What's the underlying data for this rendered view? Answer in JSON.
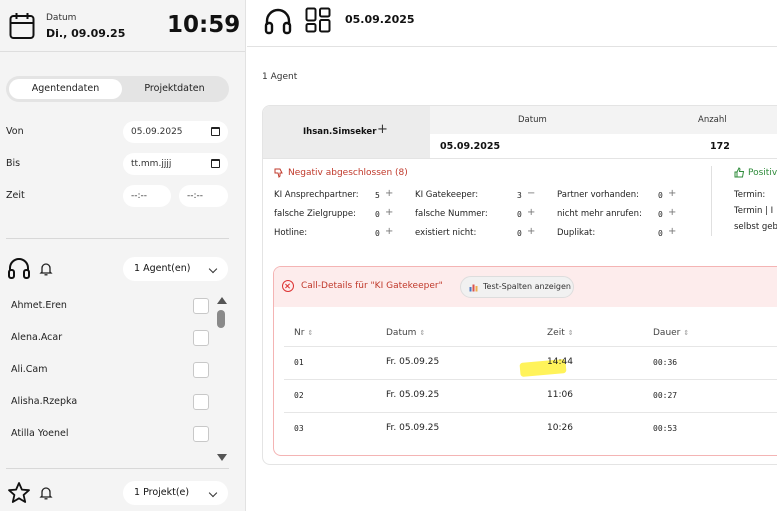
{
  "sidebar": {
    "date_label": "Datum",
    "date_value": "Di., 09.09.25",
    "clock": "10:59",
    "tabs": {
      "active": "Agentendaten",
      "inactive": "Projektdaten"
    },
    "filters": {
      "von_label": "Von",
      "von_value": "05.09.2025",
      "bis_label": "Bis",
      "bis_placeholder": "tt.mm.jjjj",
      "zeit_label": "Zeit",
      "zeit_from": "--:--",
      "zeit_to": "--:--"
    },
    "agents_dropdown": "1 Agent(en)",
    "agents": [
      "Ahmet.Eren",
      "Alena.Acar",
      "Ali.Cam",
      "Alisha.Rzepka",
      "Atilla Yoenel"
    ],
    "projects_dropdown": "1 Projekt(e)"
  },
  "topbar": {
    "date": "05.09.2025"
  },
  "main": {
    "agent_count": "1 Agent",
    "agent_tab": "Ihsan.Simseker",
    "columns": {
      "datum": "Datum",
      "anzahl": "Anzahl"
    },
    "row": {
      "datum": "05.09.2025",
      "anzahl": "172"
    },
    "negative": {
      "title": "Negativ abgeschlossen (8)",
      "items": [
        {
          "label": "KI Ansprechpartner:",
          "value": "5",
          "op": "+"
        },
        {
          "label": "falsche Zielgruppe:",
          "value": "0",
          "op": "+"
        },
        {
          "label": "Hotline:",
          "value": "0",
          "op": "+"
        },
        {
          "label": "KI Gatekeeper:",
          "value": "3",
          "op": "−"
        },
        {
          "label": "falsche Nummer:",
          "value": "0",
          "op": "+"
        },
        {
          "label": "existiert nicht:",
          "value": "0",
          "op": "+"
        },
        {
          "label": "Partner vorhanden:",
          "value": "0",
          "op": "+"
        },
        {
          "label": "nicht mehr anrufen:",
          "value": "0",
          "op": "+"
        },
        {
          "label": "Duplikat:",
          "value": "0",
          "op": "+"
        }
      ]
    },
    "positive": {
      "title": "Positiv",
      "items": [
        "Termin:",
        "Termin | I",
        "selbst geb"
      ]
    },
    "call_details": {
      "title": "Call-Details für \"KI Gatekeeper\"",
      "button": "Test-Spalten anzeigen",
      "headers": [
        "Nr",
        "Datum",
        "Zeit",
        "Dauer"
      ],
      "rows": [
        {
          "nr": "01",
          "datum": "Fr. 05.09.25",
          "zeit": "14:44",
          "dauer": "00:36"
        },
        {
          "nr": "02",
          "datum": "Fr. 05.09.25",
          "zeit": "11:06",
          "dauer": "00:27"
        },
        {
          "nr": "03",
          "datum": "Fr. 05.09.25",
          "zeit": "10:26",
          "dauer": "00:53"
        }
      ]
    }
  }
}
